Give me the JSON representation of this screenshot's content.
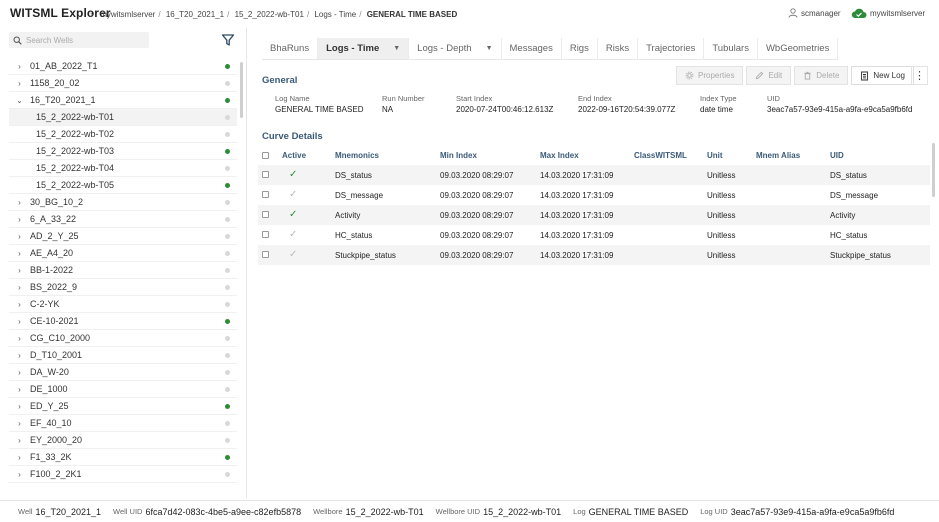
{
  "app": {
    "title": "WITSML Explorer"
  },
  "breadcrumb": [
    "mywitsmlserver",
    "16_T20_2021_1",
    "15_2_2022-wb-T01",
    "Logs - Time",
    "GENERAL TIME BASED"
  ],
  "header": {
    "user": "scmanager",
    "server": "mywitsmlserver",
    "user_icon": "person-icon",
    "server_icon": "cloud-check-icon",
    "server_icon_color": "#2e8b3a"
  },
  "sidebar": {
    "search_placeholder": "Search Wells",
    "status_on_color": "#2e8b3a",
    "items": [
      {
        "label": "01_AB_2022_T1",
        "active": true,
        "expanded": false,
        "level": 0
      },
      {
        "label": "1158_20_02",
        "active": false,
        "expanded": false,
        "level": 0
      },
      {
        "label": "16_T20_2021_1",
        "active": true,
        "expanded": true,
        "level": 0
      },
      {
        "label": "15_2_2022-wb-T01",
        "active": false,
        "level": 1,
        "selected": true
      },
      {
        "label": "15_2_2022-wb-T02",
        "active": false,
        "level": 1
      },
      {
        "label": "15_2_2022-wb-T03",
        "active": true,
        "level": 1
      },
      {
        "label": "15_2_2022-wb-T04",
        "active": false,
        "level": 1
      },
      {
        "label": "15_2_2022-wb-T05",
        "active": true,
        "level": 1
      },
      {
        "label": "30_BG_10_2",
        "active": false,
        "level": 0
      },
      {
        "label": "6_A_33_22",
        "active": false,
        "level": 0
      },
      {
        "label": "AD_2_Y_25",
        "active": false,
        "level": 0
      },
      {
        "label": "AE_A4_20",
        "active": false,
        "level": 0
      },
      {
        "label": "BB-1-2022",
        "active": false,
        "level": 0
      },
      {
        "label": "BS_2022_9",
        "active": false,
        "level": 0
      },
      {
        "label": "C-2-YK",
        "active": false,
        "level": 0
      },
      {
        "label": "CE-10-2021",
        "active": true,
        "level": 0
      },
      {
        "label": "CG_C10_2000",
        "active": false,
        "level": 0
      },
      {
        "label": "D_T10_2001",
        "active": false,
        "level": 0
      },
      {
        "label": "DA_W-20",
        "active": false,
        "level": 0
      },
      {
        "label": "DE_1000",
        "active": false,
        "level": 0
      },
      {
        "label": "ED_Y_25",
        "active": true,
        "level": 0
      },
      {
        "label": "EF_40_10",
        "active": false,
        "level": 0
      },
      {
        "label": "EY_2000_20",
        "active": false,
        "level": 0
      },
      {
        "label": "F1_33_2K",
        "active": true,
        "level": 0
      },
      {
        "label": "F100_2_2K1",
        "active": false,
        "level": 0
      }
    ]
  },
  "tabs": [
    {
      "label": "BhaRuns"
    },
    {
      "label": "Logs - Time",
      "active": true,
      "dropdown": true
    },
    {
      "label": "Logs - Depth",
      "dropdown": true
    },
    {
      "label": "Messages"
    },
    {
      "label": "Rigs"
    },
    {
      "label": "Risks"
    },
    {
      "label": "Trajectories"
    },
    {
      "label": "Tubulars"
    },
    {
      "label": "WbGeometries"
    }
  ],
  "general": {
    "title": "General",
    "actions": {
      "properties": "Properties",
      "edit": "Edit",
      "delete": "Delete",
      "new_log": "New Log"
    },
    "fields": [
      {
        "label": "Log Name",
        "value": "GENERAL TIME BASED"
      },
      {
        "label": "Run Number",
        "value": "NA"
      },
      {
        "label": "Start Index",
        "value": "2020-07-24T00:46:12.613Z"
      },
      {
        "label": "End Index",
        "value": "2022-09-16T20:54:39.077Z"
      },
      {
        "label": "Index Type",
        "value": "date time"
      },
      {
        "label": "UID",
        "value": "3eac7a57-93e9-415a-a9fa-e9ca5a9fb6fd"
      }
    ]
  },
  "curves": {
    "title": "Curve Details",
    "columns": [
      "Active",
      "Mnemonics",
      "Min Index",
      "Max Index",
      "ClassWITSML",
      "Unit",
      "Mnem Alias",
      "UID"
    ],
    "rows": [
      {
        "active": true,
        "mnemonic": "DS_status",
        "min": "09.03.2020 08:29:07",
        "max": "14.03.2020 17:31:09",
        "class": "",
        "unit": "Unitless",
        "alias": "",
        "uid": "DS_status"
      },
      {
        "active": false,
        "mnemonic": "DS_message",
        "min": "09.03.2020 08:29:07",
        "max": "14.03.2020 17:31:09",
        "class": "",
        "unit": "Unitless",
        "alias": "",
        "uid": "DS_message"
      },
      {
        "active": true,
        "mnemonic": "Activity",
        "min": "09.03.2020 08:29:07",
        "max": "14.03.2020 17:31:09",
        "class": "",
        "unit": "Unitless",
        "alias": "",
        "uid": "Activity"
      },
      {
        "active": false,
        "mnemonic": "HC_status",
        "min": "09.03.2020 08:29:07",
        "max": "14.03.2020 17:31:09",
        "class": "",
        "unit": "Unitless",
        "alias": "",
        "uid": "HC_status"
      },
      {
        "active": false,
        "mnemonic": "Stuckpipe_status",
        "min": "09.03.2020 08:29:07",
        "max": "14.03.2020 17:31:09",
        "class": "",
        "unit": "Unitless",
        "alias": "",
        "uid": "Stuckpipe_status"
      }
    ]
  },
  "statusbar": [
    {
      "label": "Well",
      "value": "16_T20_2021_1"
    },
    {
      "label": "Well UID",
      "value": "6fca7d42-083c-4be5-a9ee-c82efb5878"
    },
    {
      "label": "Wellbore",
      "value": "15_2_2022-wb-T01"
    },
    {
      "label": "Wellbore UID",
      "value": "15_2_2022-wb-T01"
    },
    {
      "label": "Log",
      "value": "GENERAL TIME BASED"
    },
    {
      "label": "Log UID",
      "value": "3eac7a57-93e9-415a-a9fa-e9ca5a9fb6fd"
    }
  ]
}
